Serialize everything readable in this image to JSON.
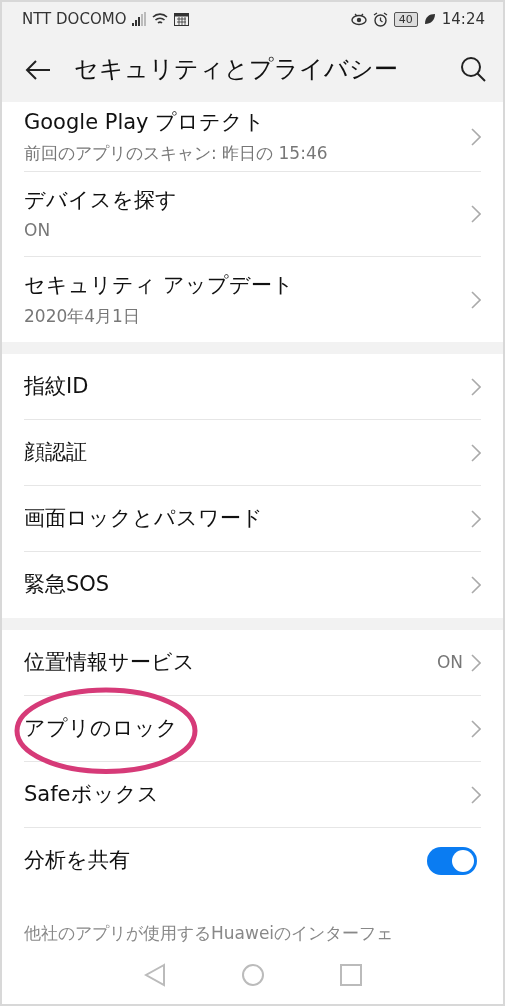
{
  "status_bar": {
    "carrier": "NTT DOCOMO",
    "battery": "40",
    "time": "14:24"
  },
  "header": {
    "title": "セキュリティとプライバシー"
  },
  "groups": [
    {
      "items": [
        {
          "kind": "link",
          "title": "Google Play プロテクト",
          "subtitle": "前回のアプリのスキャン: 昨日の 15:46",
          "highlighted": false
        },
        {
          "kind": "link",
          "title": "デバイスを探す",
          "subtitle": "ON",
          "highlighted": false
        },
        {
          "kind": "link",
          "title": "セキュリティ アップデート",
          "subtitle": "2020年4月1日",
          "highlighted": false
        }
      ]
    },
    {
      "items": [
        {
          "kind": "link",
          "title": "指紋ID",
          "highlighted": false
        },
        {
          "kind": "link",
          "title": "顔認証",
          "highlighted": false
        },
        {
          "kind": "link",
          "title": "画面ロックとパスワード",
          "highlighted": false
        },
        {
          "kind": "link",
          "title": "緊急SOS",
          "highlighted": false
        }
      ]
    },
    {
      "items": [
        {
          "kind": "link",
          "title": "位置情報サービス",
          "value": "ON",
          "highlighted": false
        },
        {
          "kind": "link",
          "title": "アプリのロック",
          "highlighted": true
        },
        {
          "kind": "link",
          "title": "Safeボックス",
          "highlighted": false
        },
        {
          "kind": "toggle",
          "title": "分析を共有",
          "on": true,
          "highlighted": false
        }
      ]
    }
  ],
  "footnote": "他社のアプリが使用するHuaweiのインターフェ"
}
